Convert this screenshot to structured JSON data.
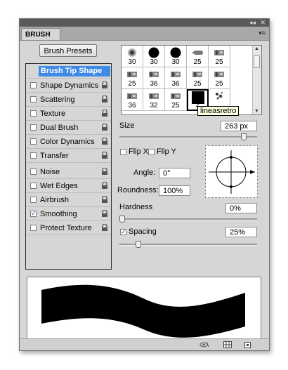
{
  "panel": {
    "tab_label": "BRUSH",
    "collapse_icon": "double-chevron-icon",
    "close_icon": "close-icon",
    "menu_icon": "panel-menu-icon"
  },
  "presets_button": "Brush Presets",
  "options": [
    {
      "label": "Brush Tip Shape",
      "selected": true,
      "has_checkbox": false,
      "has_lock": false
    },
    {
      "label": "Shape Dynamics",
      "checked": false,
      "has_lock": true
    },
    {
      "label": "Scattering",
      "checked": false,
      "has_lock": true
    },
    {
      "label": "Texture",
      "checked": false,
      "has_lock": true
    },
    {
      "label": "Dual Brush",
      "checked": false,
      "has_lock": true
    },
    {
      "label": "Color Dynamics",
      "checked": false,
      "has_lock": true
    },
    {
      "label": "Transfer",
      "checked": false,
      "has_lock": true
    },
    {
      "label": "Noise",
      "checked": false,
      "has_lock": true
    },
    {
      "label": "Wet Edges",
      "checked": false,
      "has_lock": true
    },
    {
      "label": "Airbrush",
      "checked": false,
      "has_lock": true
    },
    {
      "label": "Smoothing",
      "checked": true,
      "has_lock": true
    },
    {
      "label": "Protect Texture",
      "checked": false,
      "has_lock": true
    }
  ],
  "brush_sizes": [
    {
      "size": "30",
      "shape": "soft-round"
    },
    {
      "size": "30",
      "shape": "hard-round"
    },
    {
      "size": "30",
      "shape": "hard-round"
    },
    {
      "size": "25",
      "shape": "chalk"
    },
    {
      "size": "25",
      "shape": "textured"
    },
    {
      "size": "25",
      "shape": "textured"
    },
    {
      "size": "36",
      "shape": "textured"
    },
    {
      "size": "36",
      "shape": "textured"
    },
    {
      "size": "25",
      "shape": "textured"
    },
    {
      "size": "25",
      "shape": "textured"
    },
    {
      "size": "36",
      "shape": "textured"
    },
    {
      "size": "32",
      "shape": "textured"
    },
    {
      "size": "25",
      "shape": "textured"
    },
    {
      "size": "2",
      "shape": "custom-square",
      "selected": true
    },
    {
      "size": "",
      "shape": "splatter"
    }
  ],
  "tooltip": "lineasretro",
  "size": {
    "label": "Size",
    "value": "263 px",
    "slider_fraction": 0.92
  },
  "flip_x": {
    "label": "Flip X",
    "checked": false
  },
  "flip_y": {
    "label": "Flip Y",
    "checked": false
  },
  "angle": {
    "label": "Angle:",
    "value": "0°"
  },
  "roundness": {
    "label": "Roundness:",
    "value": "100%"
  },
  "hardness": {
    "label": "Hardness",
    "value": "0%",
    "slider_fraction": 0.0
  },
  "spacing": {
    "label": "Spacing",
    "checked": true,
    "value": "25%",
    "slider_fraction": 0.12
  },
  "bottom_icons": [
    "eye-brush-icon",
    "grid-icon",
    "new-preset-icon"
  ]
}
